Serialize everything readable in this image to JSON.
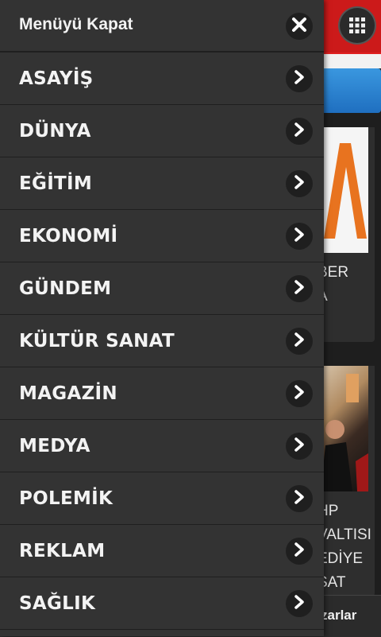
{
  "menu": {
    "close_label": "Menüyü Kapat",
    "items": [
      {
        "label": "ASAYİŞ"
      },
      {
        "label": "DÜNYA"
      },
      {
        "label": "EĞİTİM"
      },
      {
        "label": "EKONOMİ"
      },
      {
        "label": "GÜNDEM"
      },
      {
        "label": "KÜLTÜR SANAT"
      },
      {
        "label": "MAGAZİN"
      },
      {
        "label": "MEDYA"
      },
      {
        "label": "POLEMİK"
      },
      {
        "label": "REKLAM"
      },
      {
        "label": "SAĞLIK"
      }
    ]
  },
  "background": {
    "card1_text": "BER\nA",
    "card2_text": "HP\nVALTISI\nEDİYE\nSAT",
    "bottom_text": "zarlar"
  },
  "colors": {
    "menu_bg": "#333333",
    "header_red": "#cc1a1a",
    "accent_blue": "#1f6fc0"
  },
  "icons": {
    "close": "close-icon",
    "chevron": "chevron-right-icon",
    "grid": "grid-icon"
  }
}
